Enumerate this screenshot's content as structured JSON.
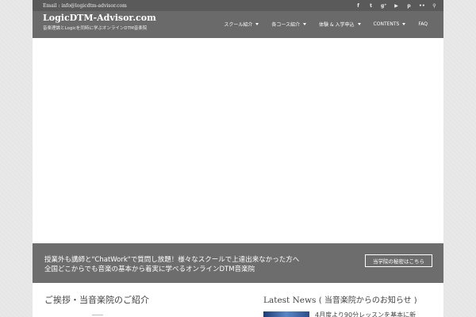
{
  "topbar": {
    "email": "Email : info@logicdtm-advisor.com",
    "social_icons": [
      "facebook-icon",
      "twitter-icon",
      "google-plus-icon",
      "youtube-icon",
      "pinterest-icon",
      "flickr-icon",
      "search-icon"
    ],
    "social_glyphs": [
      "f",
      "t",
      "g⁺",
      "▶",
      "p",
      "••",
      "⚲"
    ]
  },
  "header": {
    "site_title": "LogicDTM-Advisor.com",
    "site_description": "音楽理論とLogicを同時に学ぶオンラインDTM音楽院",
    "nav": [
      {
        "label": "スクール紹介",
        "has_dropdown": true
      },
      {
        "label": "各コース紹介",
        "has_dropdown": true
      },
      {
        "label": "体験 & 入学申込",
        "has_dropdown": true
      },
      {
        "label": "CONTENTS",
        "has_dropdown": true
      },
      {
        "label": "FAQ",
        "has_dropdown": false
      }
    ]
  },
  "banner": {
    "line1": "授業外も講師と\"ChatWork\"で質問し放題！様々なスクールで上達出来なかった方へ",
    "line2": "全国どこからでも音楽の基本から着実に学べるオンラインDTM音楽院",
    "button_label": "当学院の秘密はこちら"
  },
  "sections": {
    "greeting_title": "ご挨拶・当音楽院のご紹介",
    "latest_title_en": "Latest News",
    "latest_title_jp": "( 当音楽院からのお知らせ )",
    "news_item_title": "4月度より90分レッスンを基本に新"
  },
  "colors": {
    "topbar_bg": "#5a5a5a",
    "header_bg": "#6a6a6a",
    "banner_bg": "#6d6d6d",
    "page_bg": "#e8e8e8"
  }
}
